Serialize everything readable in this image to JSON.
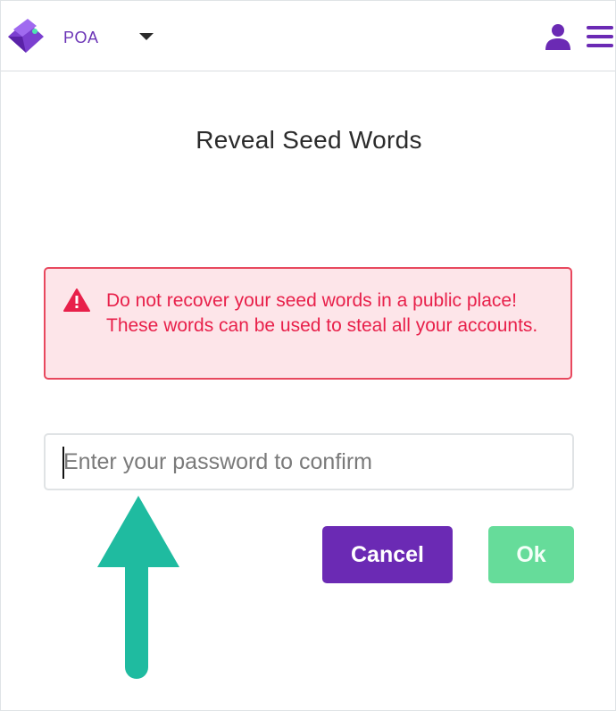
{
  "header": {
    "network_label": "POA",
    "logo_icon": "wallet-logo-icon",
    "caret_icon": "caret-down-icon",
    "account_icon": "account-icon",
    "menu_icon": "hamburger-menu-icon"
  },
  "page": {
    "title": "Reveal Seed Words"
  },
  "warning": {
    "icon": "warning-triangle-icon",
    "text": "Do not recover your seed words in a public place! These words can be used to steal all your accounts."
  },
  "password": {
    "placeholder": "Enter your password to confirm",
    "value": ""
  },
  "buttons": {
    "cancel_label": "Cancel",
    "ok_label": "Ok"
  },
  "colors": {
    "brand_purple": "#6b2ab4",
    "warning_red": "#e8204a",
    "warning_bg": "#fde5e9",
    "ok_green": "#66dc9a",
    "annotation_arrow": "#1fbba0"
  }
}
